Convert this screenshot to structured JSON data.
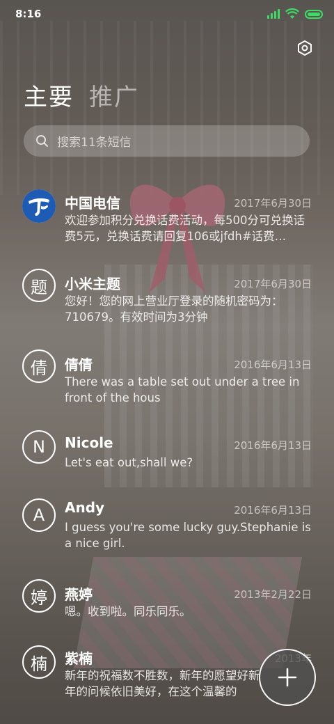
{
  "status_bar": {
    "time": "8:16"
  },
  "tabs": [
    {
      "label": "主要",
      "active": true
    },
    {
      "label": "推广",
      "active": false
    }
  ],
  "search": {
    "placeholder": "搜索11条短信"
  },
  "messages": [
    {
      "avatar": "中国电信-logo",
      "sender": "中国电信",
      "date": "2017年6月30日",
      "preview": "欢迎参加积分兑换话费活动，每500分可兑换话费5元，兑换话费请回复106或jfdh#话费…"
    },
    {
      "avatar": "题",
      "sender": "小米主题",
      "date": "2017年6月30日",
      "preview": "您好！您的网上营业厅登录的随机密码为：710679。有效时间为3分钟"
    },
    {
      "avatar": "倩",
      "sender": "倩倩",
      "date": "2016年6月13日",
      "preview": "There was a table set out under a tree in front of the hous"
    },
    {
      "avatar": "N",
      "sender": "Nicole",
      "date": "2016年6月13日",
      "preview": "Let's eat out,shall we?"
    },
    {
      "avatar": "A",
      "sender": "Andy",
      "date": "2016年6月13日",
      "preview": "I guess you're some lucky guy.Stephanie is a nice girl."
    },
    {
      "avatar": "婷",
      "sender": "燕婷",
      "date": "2013年2月22日",
      "preview": "嗯。收到啦。同乐同乐。"
    },
    {
      "avatar": "楠",
      "sender": "紫楠",
      "date": "2013年",
      "preview": "新年的祝福数不胜数，新年的愿望好新年的问候依旧美好，在这个温馨的"
    }
  ],
  "icons": {
    "settings": "hexagon-settings-icon",
    "search": "search-icon",
    "compose": "plus-icon"
  },
  "colors": {
    "status_green": "#3ddc65",
    "telecom_blue": "#1d5bb5"
  }
}
